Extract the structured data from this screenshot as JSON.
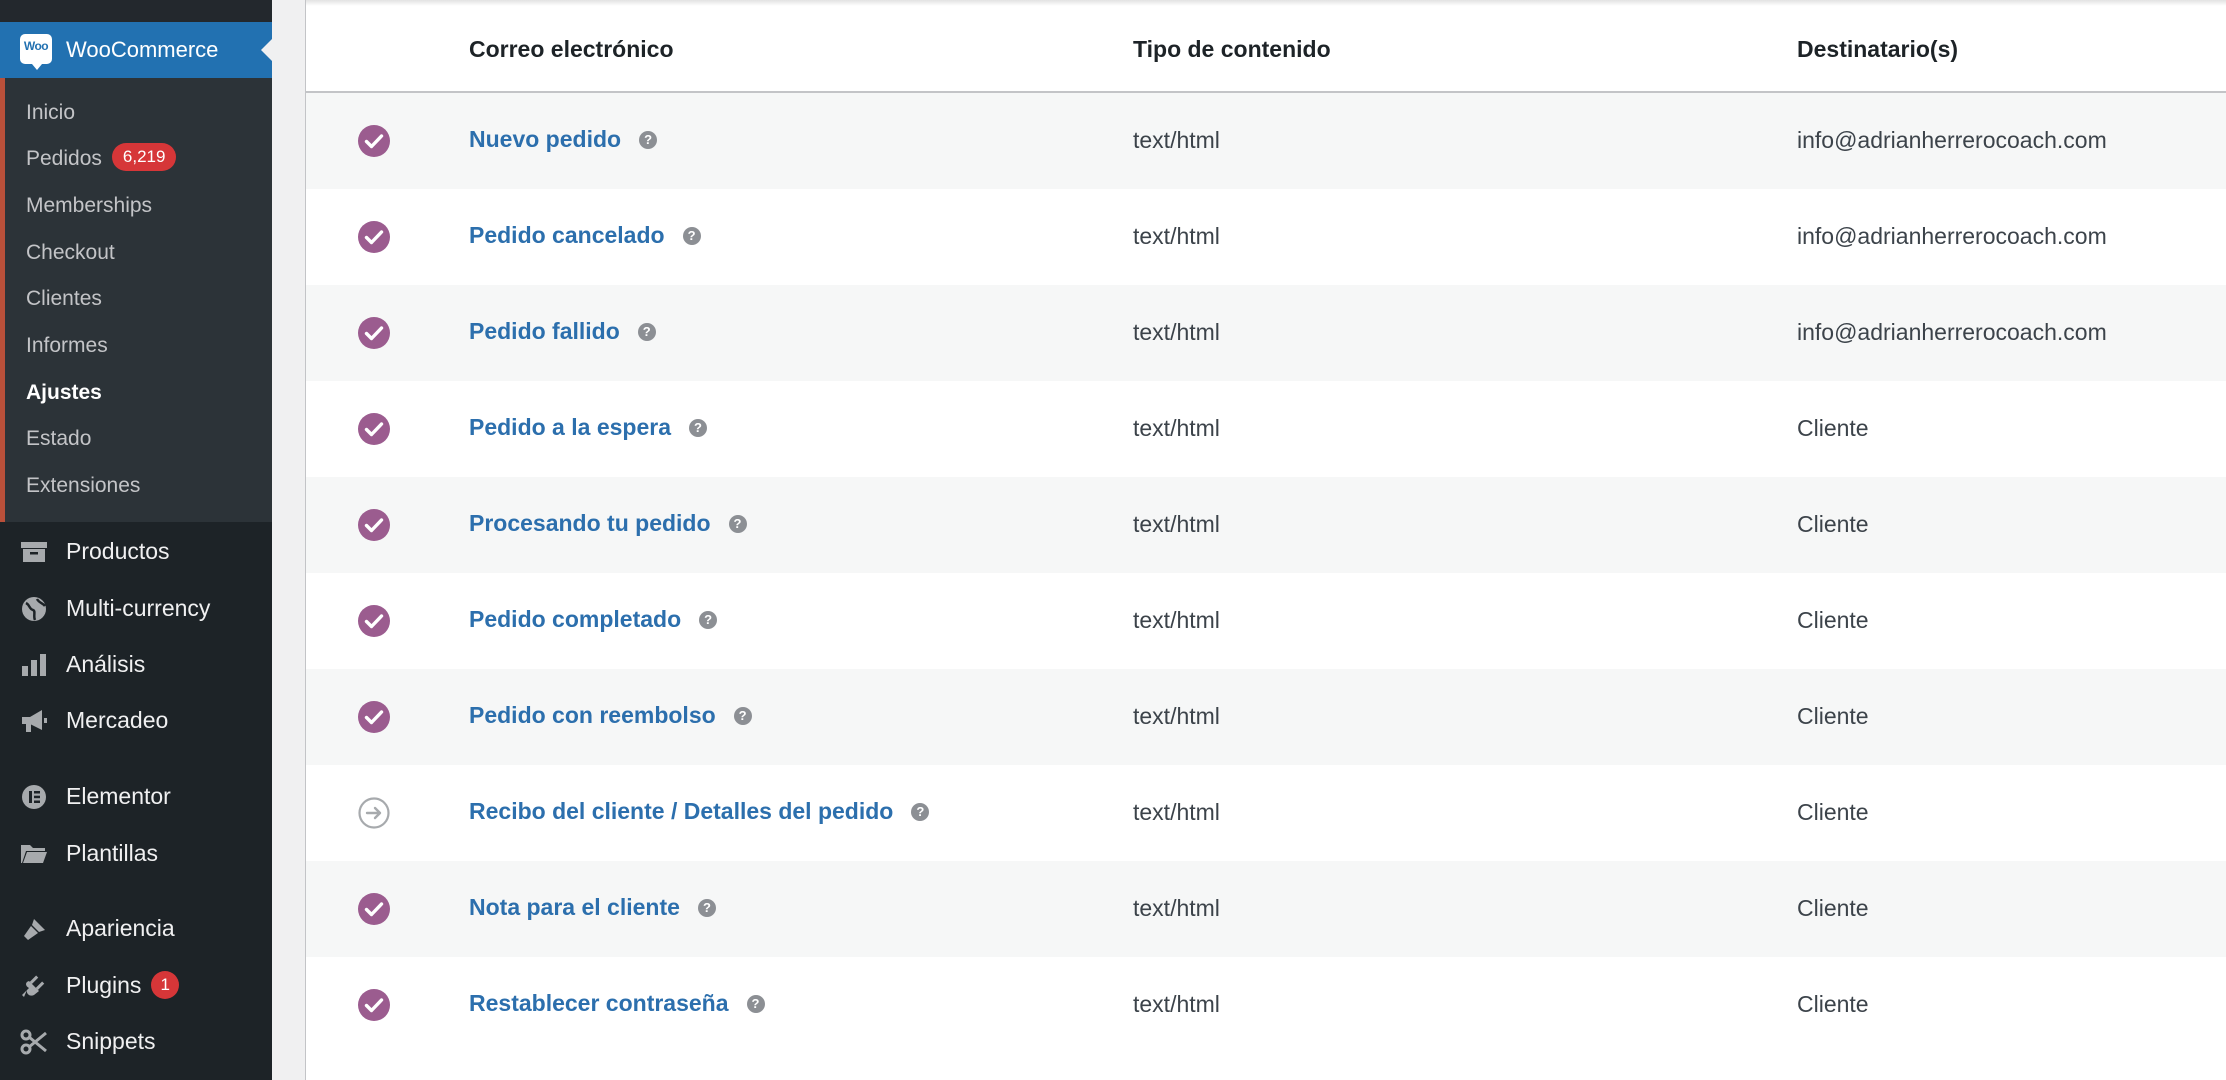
{
  "sidebar": {
    "plugin_title": "WooCommerce",
    "plugin_logo_text": "Woo",
    "submenu": [
      {
        "label": "Inicio"
      },
      {
        "label": "Pedidos",
        "badge": "6,219"
      },
      {
        "label": "Memberships"
      },
      {
        "label": "Checkout"
      },
      {
        "label": "Clientes"
      },
      {
        "label": "Informes"
      },
      {
        "label": "Ajustes",
        "current": true
      },
      {
        "label": "Estado"
      },
      {
        "label": "Extensiones"
      }
    ],
    "menu": [
      {
        "label": "Productos",
        "icon": "archive-icon"
      },
      {
        "label": "Multi-currency",
        "icon": "globe-icon"
      },
      {
        "label": "Análisis",
        "icon": "bar-chart-icon"
      },
      {
        "label": "Mercadeo",
        "icon": "megaphone-icon"
      },
      {
        "label": "Elementor",
        "icon": "elementor-icon"
      },
      {
        "label": "Plantillas",
        "icon": "folder-icon"
      },
      {
        "label": "Apariencia",
        "icon": "paintbrush-icon"
      },
      {
        "label": "Plugins",
        "icon": "plug-icon",
        "badge": "1"
      },
      {
        "label": "Snippets",
        "icon": "scissors-icon"
      }
    ]
  },
  "table": {
    "headers": {
      "email": "Correo electrónico",
      "content_type": "Tipo de contenido",
      "recipients": "Destinatario(s)"
    },
    "help_symbol": "?",
    "rows": [
      {
        "name": "Nuevo pedido",
        "status": "enabled",
        "content_type": "text/html",
        "recipient": "info@adrianherrerocoach.com"
      },
      {
        "name": "Pedido cancelado",
        "status": "enabled",
        "content_type": "text/html",
        "recipient": "info@adrianherrerocoach.com"
      },
      {
        "name": "Pedido fallido",
        "status": "enabled",
        "content_type": "text/html",
        "recipient": "info@adrianherrerocoach.com"
      },
      {
        "name": "Pedido a la espera",
        "status": "enabled",
        "content_type": "text/html",
        "recipient": "Cliente"
      },
      {
        "name": "Procesando tu pedido",
        "status": "enabled",
        "content_type": "text/html",
        "recipient": "Cliente"
      },
      {
        "name": "Pedido completado",
        "status": "enabled",
        "content_type": "text/html",
        "recipient": "Cliente"
      },
      {
        "name": "Pedido con reembolso",
        "status": "enabled",
        "content_type": "text/html",
        "recipient": "Cliente"
      },
      {
        "name": "Recibo del cliente / Detalles del pedido",
        "status": "manual",
        "content_type": "text/html",
        "recipient": "Cliente"
      },
      {
        "name": "Nota para el cliente",
        "status": "enabled",
        "content_type": "text/html",
        "recipient": "Cliente"
      },
      {
        "name": "Restablecer contraseña",
        "status": "enabled",
        "content_type": "text/html",
        "recipient": "Cliente"
      }
    ]
  },
  "colors": {
    "sidebar_bg": "#1d2327",
    "submenu_bg": "#2c3338",
    "active_bg": "#2271b1",
    "link": "#2c6fad",
    "enabled_icon": "#9b5c8f",
    "manual_icon": "#a7aaad",
    "badge_red": "#d63638"
  }
}
